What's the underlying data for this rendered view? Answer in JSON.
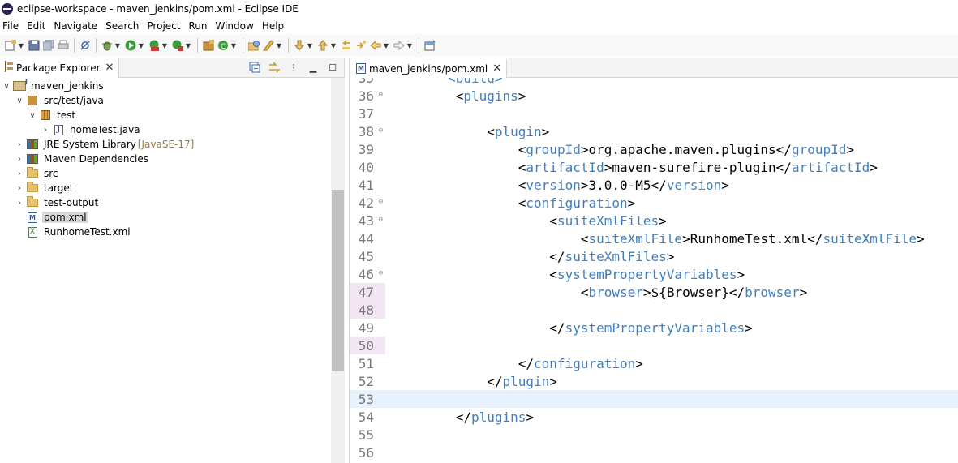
{
  "window": {
    "title": "eclipse-workspace - maven_jenkins/pom.xml - Eclipse IDE"
  },
  "menu": [
    "File",
    "Edit",
    "Navigate",
    "Search",
    "Project",
    "Run",
    "Window",
    "Help"
  ],
  "package_explorer": {
    "tab_label": "Package Explorer",
    "tree": [
      {
        "label": "maven_jenkins",
        "decoration": "",
        "depth": 0,
        "expanded": true,
        "icon": "project-icon"
      },
      {
        "label": "src/test/java",
        "decoration": "",
        "depth": 1,
        "expanded": true,
        "icon": "source-folder-icon"
      },
      {
        "label": "test",
        "decoration": "",
        "depth": 2,
        "expanded": true,
        "icon": "package-icon"
      },
      {
        "label": "homeTest.java",
        "decoration": "",
        "depth": 3,
        "expanded": false,
        "icon": "java-file-icon"
      },
      {
        "label": "JRE System Library",
        "decoration": "[JavaSE-17]",
        "depth": 1,
        "expanded": false,
        "icon": "library-icon"
      },
      {
        "label": "Maven Dependencies",
        "decoration": "",
        "depth": 1,
        "expanded": false,
        "icon": "library-icon"
      },
      {
        "label": "src",
        "decoration": "",
        "depth": 1,
        "expanded": false,
        "icon": "folder-icon"
      },
      {
        "label": "target",
        "decoration": "",
        "depth": 1,
        "expanded": false,
        "icon": "folder-icon"
      },
      {
        "label": "test-output",
        "decoration": "",
        "depth": 1,
        "expanded": false,
        "icon": "folder-icon"
      },
      {
        "label": "pom.xml",
        "decoration": "",
        "depth": 1,
        "leaf": true,
        "selected": true,
        "icon": "maven-file-icon"
      },
      {
        "label": "RunhomeTest.xml",
        "decoration": "",
        "depth": 1,
        "leaf": true,
        "icon": "xml-file-icon"
      }
    ]
  },
  "editor": {
    "tab_label": "maven_jenkins/pom.xml",
    "partial_top_line": "<build>",
    "lines": [
      {
        "n": "36",
        "indent": 2,
        "text": "<plugins>",
        "fold": true
      },
      {
        "n": "37",
        "indent": 0,
        "text": ""
      },
      {
        "n": "38",
        "indent": 3,
        "text": "<plugin>",
        "fold": true
      },
      {
        "n": "39",
        "indent": 4,
        "text": "<groupId>org.apache.maven.plugins</groupId>"
      },
      {
        "n": "40",
        "indent": 4,
        "text": "<artifactId>maven-surefire-plugin</artifactId>"
      },
      {
        "n": "41",
        "indent": 4,
        "text": "<version>3.0.0-M5</version>"
      },
      {
        "n": "42",
        "indent": 4,
        "text": "<configuration>",
        "fold": true
      },
      {
        "n": "43",
        "indent": 5,
        "text": "<suiteXmlFiles>",
        "fold": true
      },
      {
        "n": "44",
        "indent": 6,
        "text": "<suiteXmlFile>RunhomeTest.xml</suiteXmlFile>"
      },
      {
        "n": "45",
        "indent": 5,
        "text": "</suiteXmlFiles>"
      },
      {
        "n": "46",
        "indent": 5,
        "text": "<systemPropertyVariables>",
        "fold": true
      },
      {
        "n": "47",
        "indent": 6,
        "text": "<browser>${Browser}</browser>",
        "marked": true
      },
      {
        "n": "48",
        "indent": 0,
        "text": "",
        "marked": true
      },
      {
        "n": "49",
        "indent": 5,
        "text": "</systemPropertyVariables>"
      },
      {
        "n": "50",
        "indent": 0,
        "text": "",
        "marked": true
      },
      {
        "n": "51",
        "indent": 4,
        "text": "</configuration>"
      },
      {
        "n": "52",
        "indent": 3,
        "text": "</plugin>"
      },
      {
        "n": "53",
        "indent": 0,
        "text": "",
        "current": true
      },
      {
        "n": "54",
        "indent": 2,
        "text": "</plugins>"
      },
      {
        "n": "55",
        "indent": 0,
        "text": ""
      },
      {
        "n": "56",
        "indent": 0,
        "text": ""
      }
    ]
  },
  "colors": {
    "tag": "#3f7fbf",
    "current_line": "#e8f2fe",
    "line_number": "#787878"
  }
}
